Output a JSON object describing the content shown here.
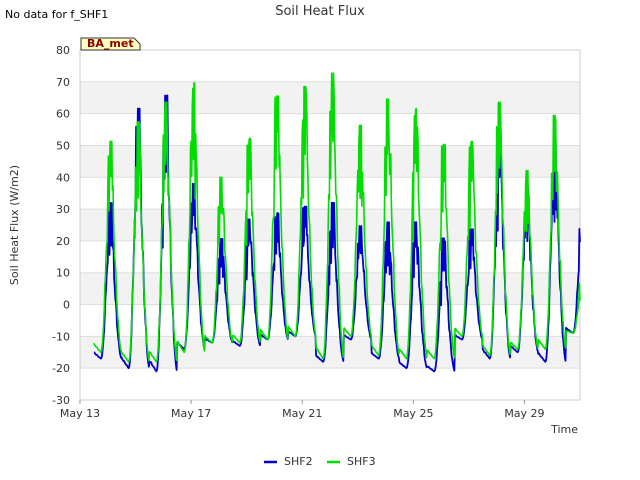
{
  "notice": "No data for f_SHF1",
  "chart_data": {
    "type": "line",
    "title": "Soil Heat Flux",
    "xlabel": "Time",
    "ylabel": "Soil Heat Flux (W/m2)",
    "ylim": [
      -30,
      80
    ],
    "yticks": [
      -30,
      -20,
      -10,
      0,
      10,
      20,
      30,
      40,
      50,
      60,
      70,
      80
    ],
    "xlim": [
      "2016-05-13",
      "2016-05-31"
    ],
    "xticks": [
      {
        "date": "2016-05-13",
        "label": "May 13"
      },
      {
        "date": "2016-05-17",
        "label": "May 17"
      },
      {
        "date": "2016-05-21",
        "label": "May 21"
      },
      {
        "date": "2016-05-25",
        "label": "May 25"
      },
      {
        "date": "2016-05-29",
        "label": "May 29"
      }
    ],
    "grid": true,
    "badge": "BA_met",
    "legend_position": "bottom",
    "series": [
      {
        "name": "SHF2",
        "color": "#0000cc",
        "daily_min": [
          -17,
          -20,
          -21,
          -14,
          -12,
          -13,
          -11,
          -10,
          -18,
          -11,
          -17,
          -20,
          -21,
          -11,
          -17,
          -15,
          -18,
          -9
        ],
        "daily_max": [
          31,
          60,
          64,
          37,
          20,
          26,
          28,
          30,
          31,
          24,
          25,
          25,
          20,
          23,
          53,
          36,
          50,
          30
        ]
      },
      {
        "name": "SHF3",
        "color": "#00dd00",
        "daily_min": [
          -15,
          -18,
          -18,
          -15,
          -12,
          -12,
          -11,
          -10,
          -17,
          -10,
          -16,
          -17,
          -17,
          -10,
          -16,
          -14,
          -14,
          -9
        ],
        "daily_max": [
          50,
          56,
          62,
          68,
          39,
          51,
          64,
          67,
          71,
          55,
          63,
          60,
          49,
          50,
          62,
          41,
          58,
          10
        ]
      }
    ]
  }
}
